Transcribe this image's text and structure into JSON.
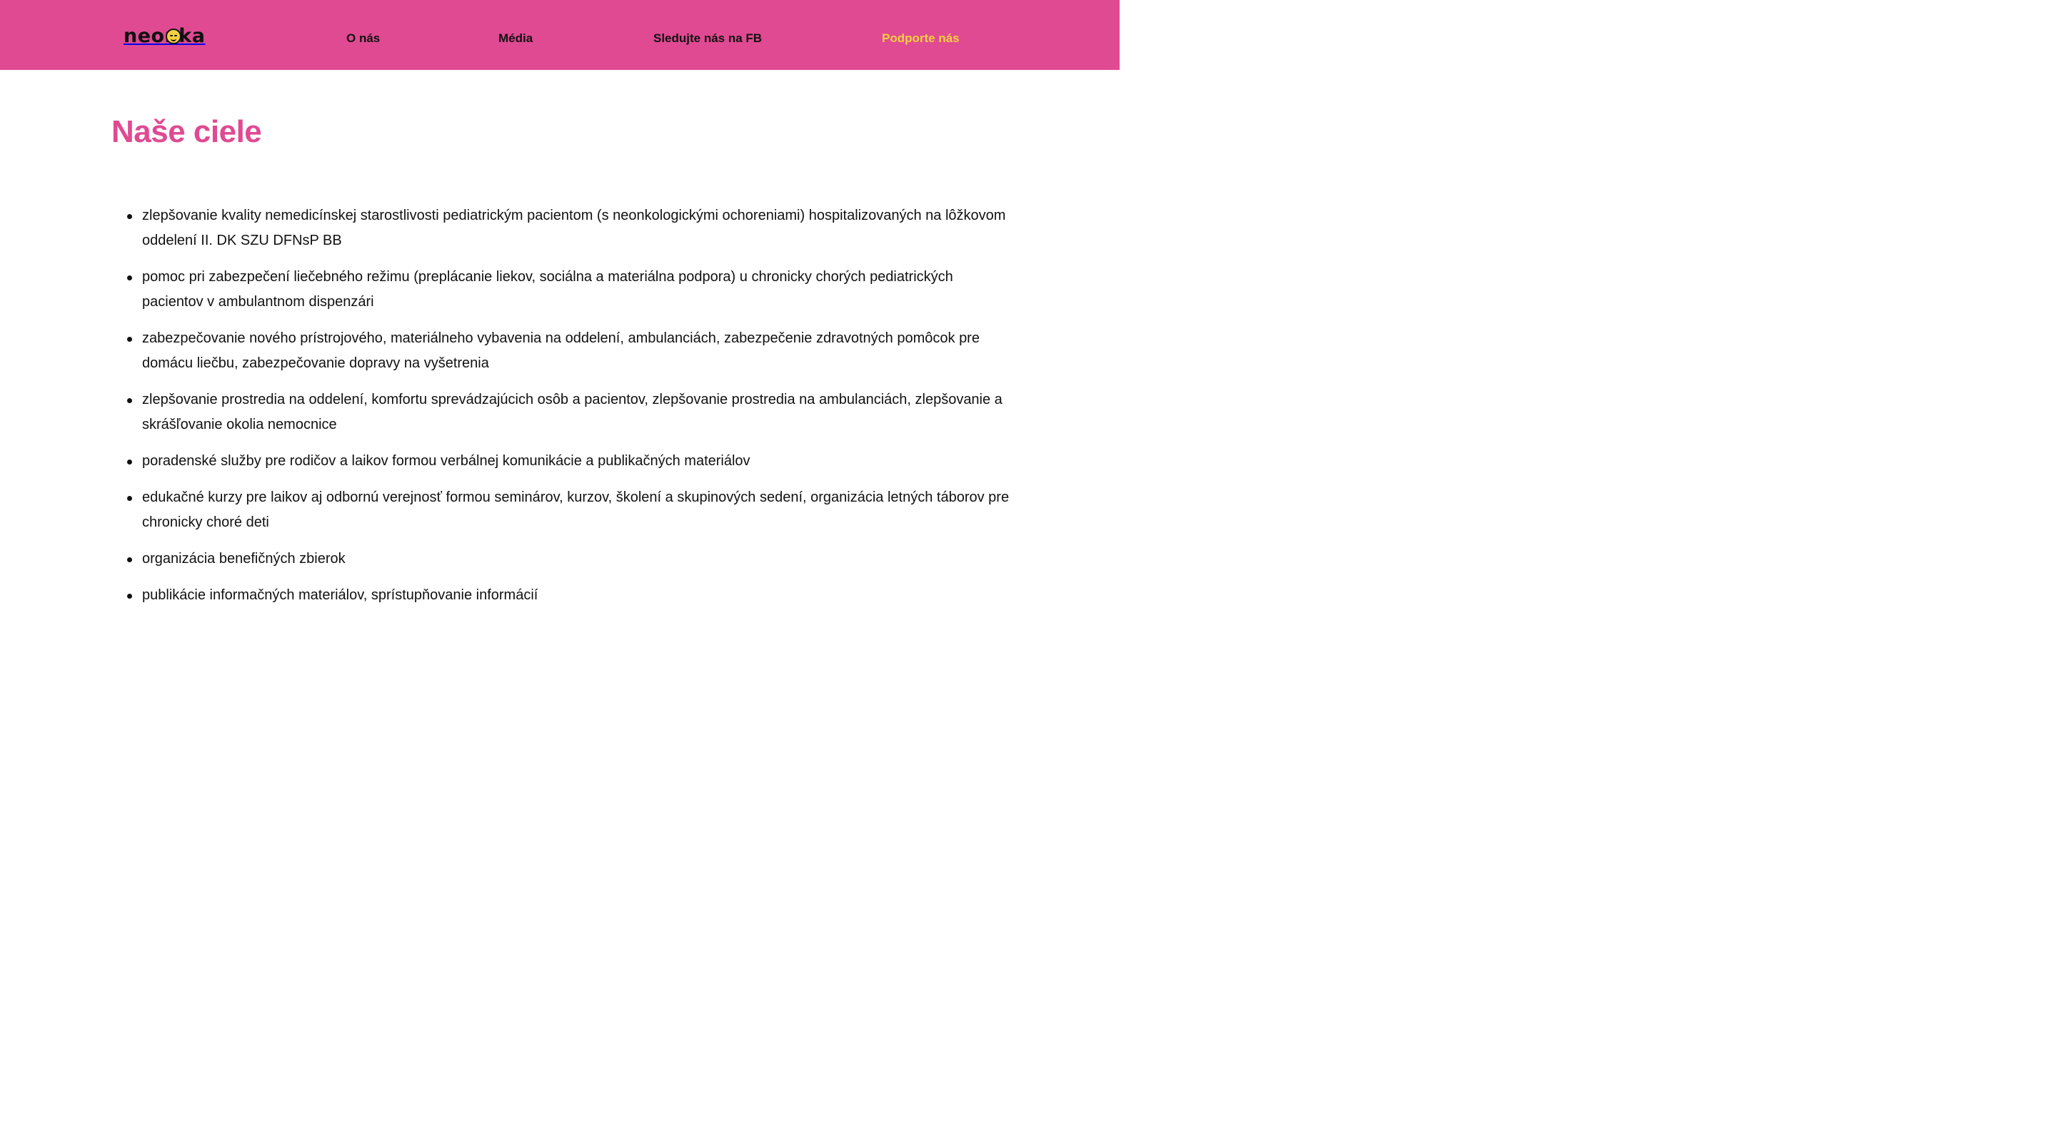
{
  "header": {
    "logo_text": "neonka",
    "nav": [
      {
        "label": "O nás"
      },
      {
        "label": "Média"
      },
      {
        "label": "Sledujte nás na FB"
      },
      {
        "label": "Podporte nás"
      }
    ]
  },
  "main": {
    "title": "Naše ciele",
    "goals": [
      "zlepšovanie kvality nemedicínskej starostlivosti pediatrickým pacientom (s neonkologickými ochoreniami) hospitalizovaných na lôžkovom oddelení II. DK SZU DFNsP BB",
      "pomoc pri zabezpečení liečebného režimu (preplácanie liekov, sociálna a materiálna podpora) u chronicky chorých pediatrických pacientov v ambulantnom dispenzári",
      "zabezpečovanie nového prístrojového, materiálneho vybavenia na oddelení, ambulanciách, zabezpečenie zdravotných pomôcok pre domácu liečbu, zabezpečovanie dopravy na vyšetrenia",
      "zlepšovanie prostredia na oddelení, komfortu sprevádzajúcich osôb a pacientov, zlepšovanie prostredia na ambulanciách, zlepšovanie a skrášľovanie okolia nemocnice",
      "poradenské služby pre rodičov a laikov formou verbálnej komunikácie a publikačných materiálov",
      "edukačné kurzy pre laikov aj odbornú verejnosť formou seminárov, kurzov, školení a skupinových sedení, organizácia letných táborov pre chronicky choré deti",
      "organizácia benefičných zbierok",
      "publikácie informačných materiálov, sprístupňovanie informácií"
    ]
  },
  "colors": {
    "brand_pink": "#e04a92",
    "accent_yellow": "#f4d03f",
    "text": "#111111",
    "background": "#ffffff"
  }
}
